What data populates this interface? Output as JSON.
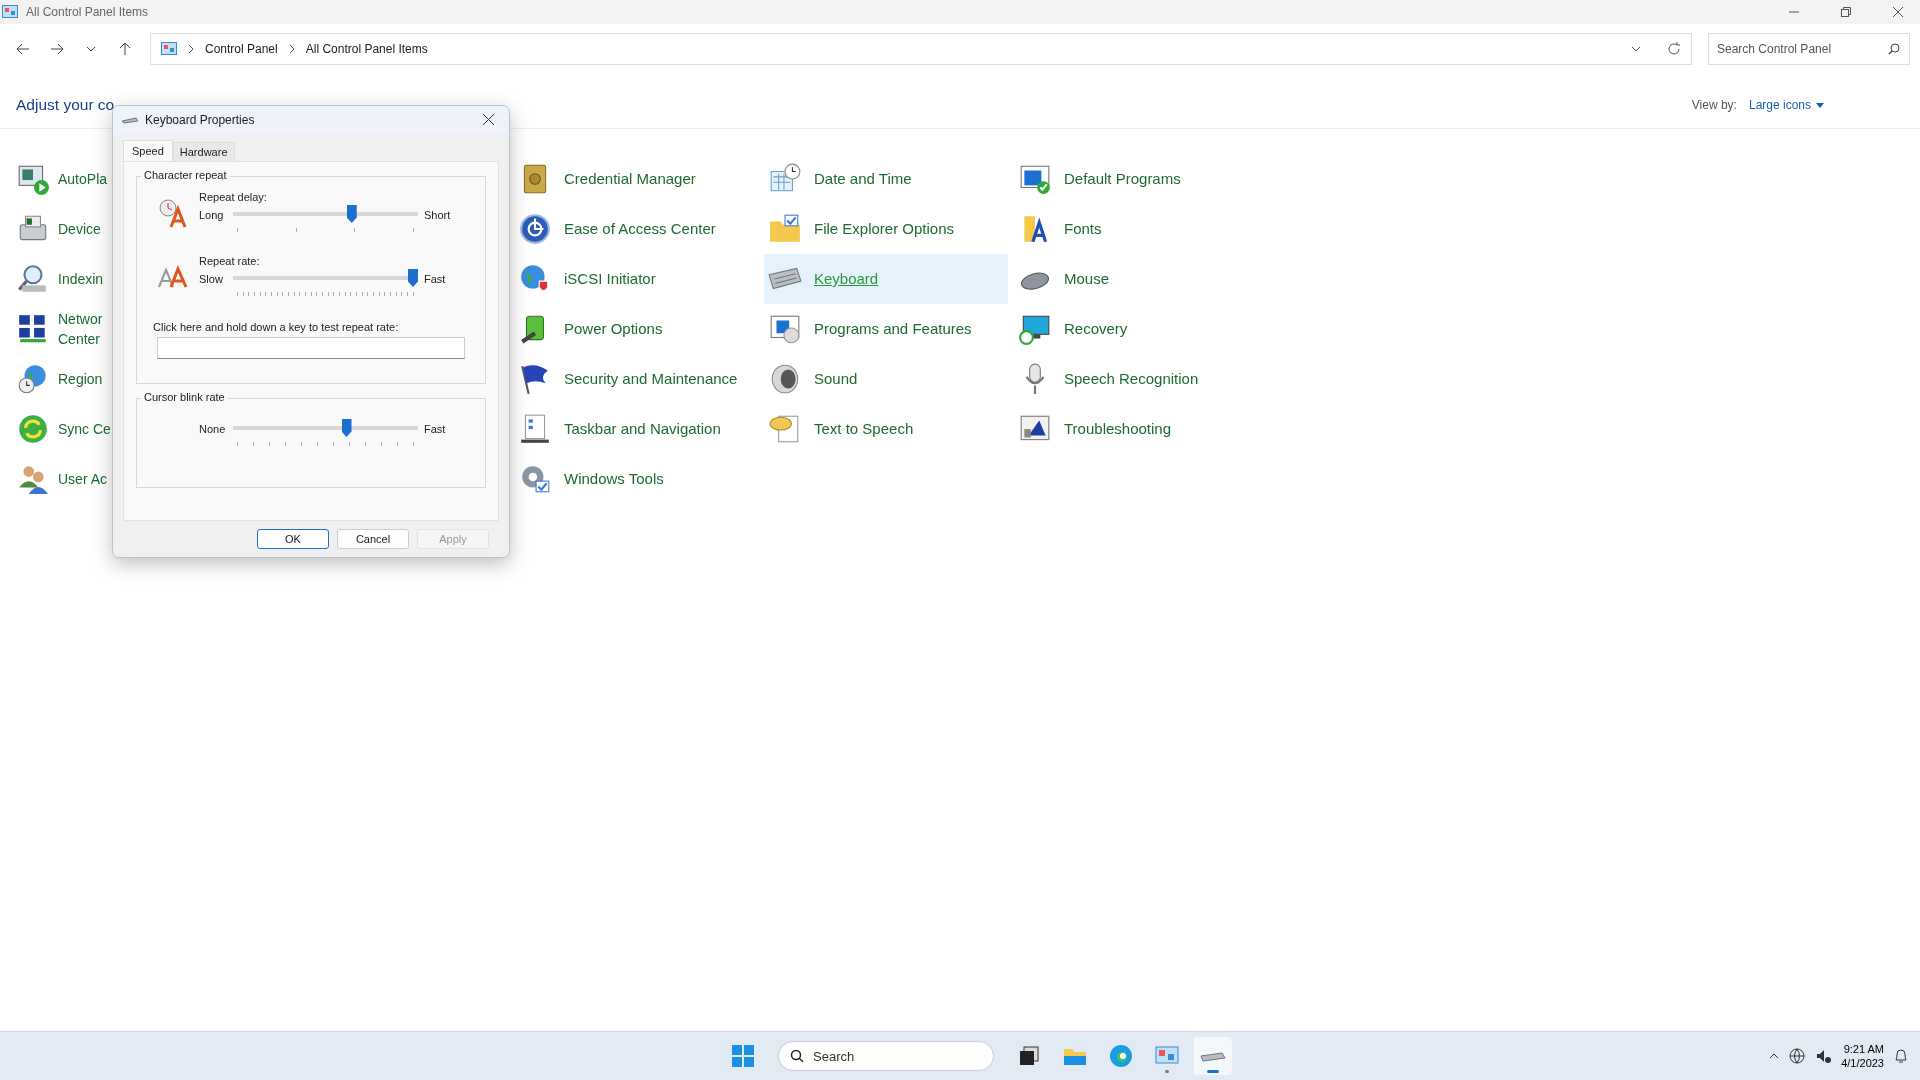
{
  "window": {
    "title": "All Control Panel Items"
  },
  "address_bar": {
    "path": [
      "Control Panel",
      "All Control Panel Items"
    ]
  },
  "search": {
    "placeholder": "Search Control Panel"
  },
  "heading": "Adjust your co",
  "view_by": {
    "label": "View by:",
    "value": "Large icons"
  },
  "columns": [
    [
      {
        "label": "AutoPla",
        "selected": false
      },
      {
        "label": "Device",
        "selected": false
      },
      {
        "label": "Indexin",
        "selected": false
      },
      {
        "label": "Networ\nCenter",
        "selected": false
      },
      {
        "label": "Region",
        "selected": false
      },
      {
        "label": "Sync Ce",
        "selected": false
      },
      {
        "label": "User Ac",
        "selected": false
      }
    ],
    [
      {
        "label": "Credential Manager",
        "selected": false
      },
      {
        "label": "Ease of Access Center",
        "selected": false
      },
      {
        "label": "iSCSI Initiator",
        "selected": false
      },
      {
        "label": "Power Options",
        "selected": false
      },
      {
        "label": "Security and Maintenance",
        "selected": false
      },
      {
        "label": "Taskbar and Navigation",
        "selected": false
      },
      {
        "label": "Windows Tools",
        "selected": false
      }
    ],
    [
      {
        "label": "Date and Time",
        "selected": false
      },
      {
        "label": "File Explorer Options",
        "selected": false
      },
      {
        "label": "Keyboard",
        "selected": true
      },
      {
        "label": "Programs and Features",
        "selected": false
      },
      {
        "label": "Sound",
        "selected": false
      },
      {
        "label": "Text to Speech",
        "selected": false
      }
    ],
    [
      {
        "label": "Default Programs",
        "selected": false
      },
      {
        "label": "Fonts",
        "selected": false
      },
      {
        "label": "Mouse",
        "selected": false
      },
      {
        "label": "Recovery",
        "selected": false
      },
      {
        "label": "Speech Recognition",
        "selected": false
      },
      {
        "label": "Troubleshooting",
        "selected": false
      }
    ]
  ],
  "dialog": {
    "title": "Keyboard Properties",
    "tabs": [
      {
        "label": "Speed",
        "selected": true
      },
      {
        "label": "Hardware",
        "selected": false
      }
    ],
    "groups": [
      {
        "title": "Character repeat",
        "sliders": [
          {
            "label": "Repeat delay:",
            "min_label": "Long",
            "max_label": "Short",
            "level": 0.65
          },
          {
            "label": "Repeat rate:",
            "min_label": "Slow",
            "max_label": "Fast",
            "level": 1
          }
        ],
        "test_field": {
          "label": "Click here and hold down a key to test repeat rate:"
        }
      },
      {
        "title": "Cursor blink rate",
        "sliders": [
          {
            "min_label": "None",
            "max_label": "Fast",
            "level": 0.62
          }
        ]
      }
    ],
    "buttons": [
      {
        "label": "OK",
        "default": true,
        "disabled": false
      },
      {
        "label": "Cancel",
        "default": false,
        "disabled": false
      },
      {
        "label": "Apply",
        "default": false,
        "disabled": true
      }
    ]
  },
  "taskbar": {
    "search_placeholder": "Search",
    "time": "9:21 AM",
    "date": "4/1/2023"
  }
}
